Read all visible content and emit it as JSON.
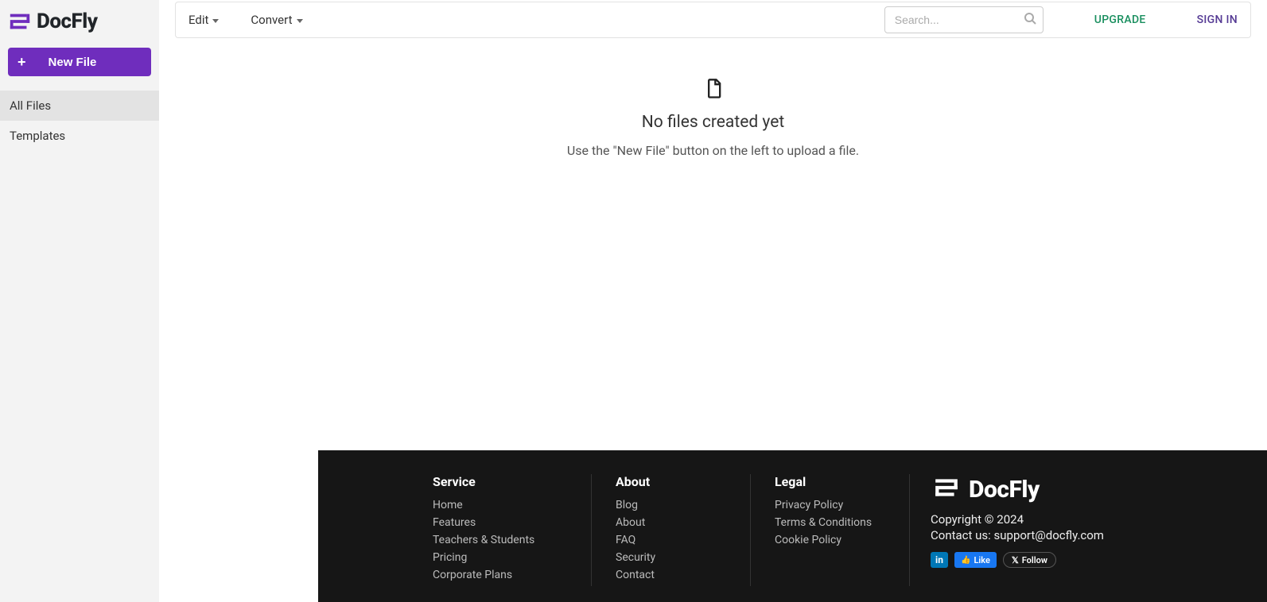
{
  "brand": {
    "name": "DocFly",
    "accent": "#6f2dbd"
  },
  "sidebar": {
    "new_file_label": "New File",
    "items": [
      {
        "label": "All Files",
        "active": true
      },
      {
        "label": "Templates",
        "active": false
      }
    ]
  },
  "topbar": {
    "edit_label": "Edit",
    "convert_label": "Convert",
    "search_placeholder": "Search...",
    "upgrade_label": "UPGRADE",
    "signin_label": "SIGN IN"
  },
  "empty": {
    "title": "No files created yet",
    "subtitle": "Use the \"New File\" button on the left to upload a file."
  },
  "footer": {
    "service": {
      "heading": "Service",
      "links": [
        "Home",
        "Features",
        "Teachers & Students",
        "Pricing",
        "Corporate Plans"
      ]
    },
    "about": {
      "heading": "About",
      "links": [
        "Blog",
        "About",
        "FAQ",
        "Security",
        "Contact"
      ]
    },
    "legal": {
      "heading": "Legal",
      "links": [
        "Privacy Policy",
        "Terms & Conditions",
        "Cookie Policy"
      ]
    },
    "copyright": "Copyright © 2024",
    "contact_prefix": "Contact us: ",
    "contact_email": "support@docfly.com",
    "social": {
      "linkedin": "in",
      "like": "Like",
      "follow": "Follow"
    }
  }
}
